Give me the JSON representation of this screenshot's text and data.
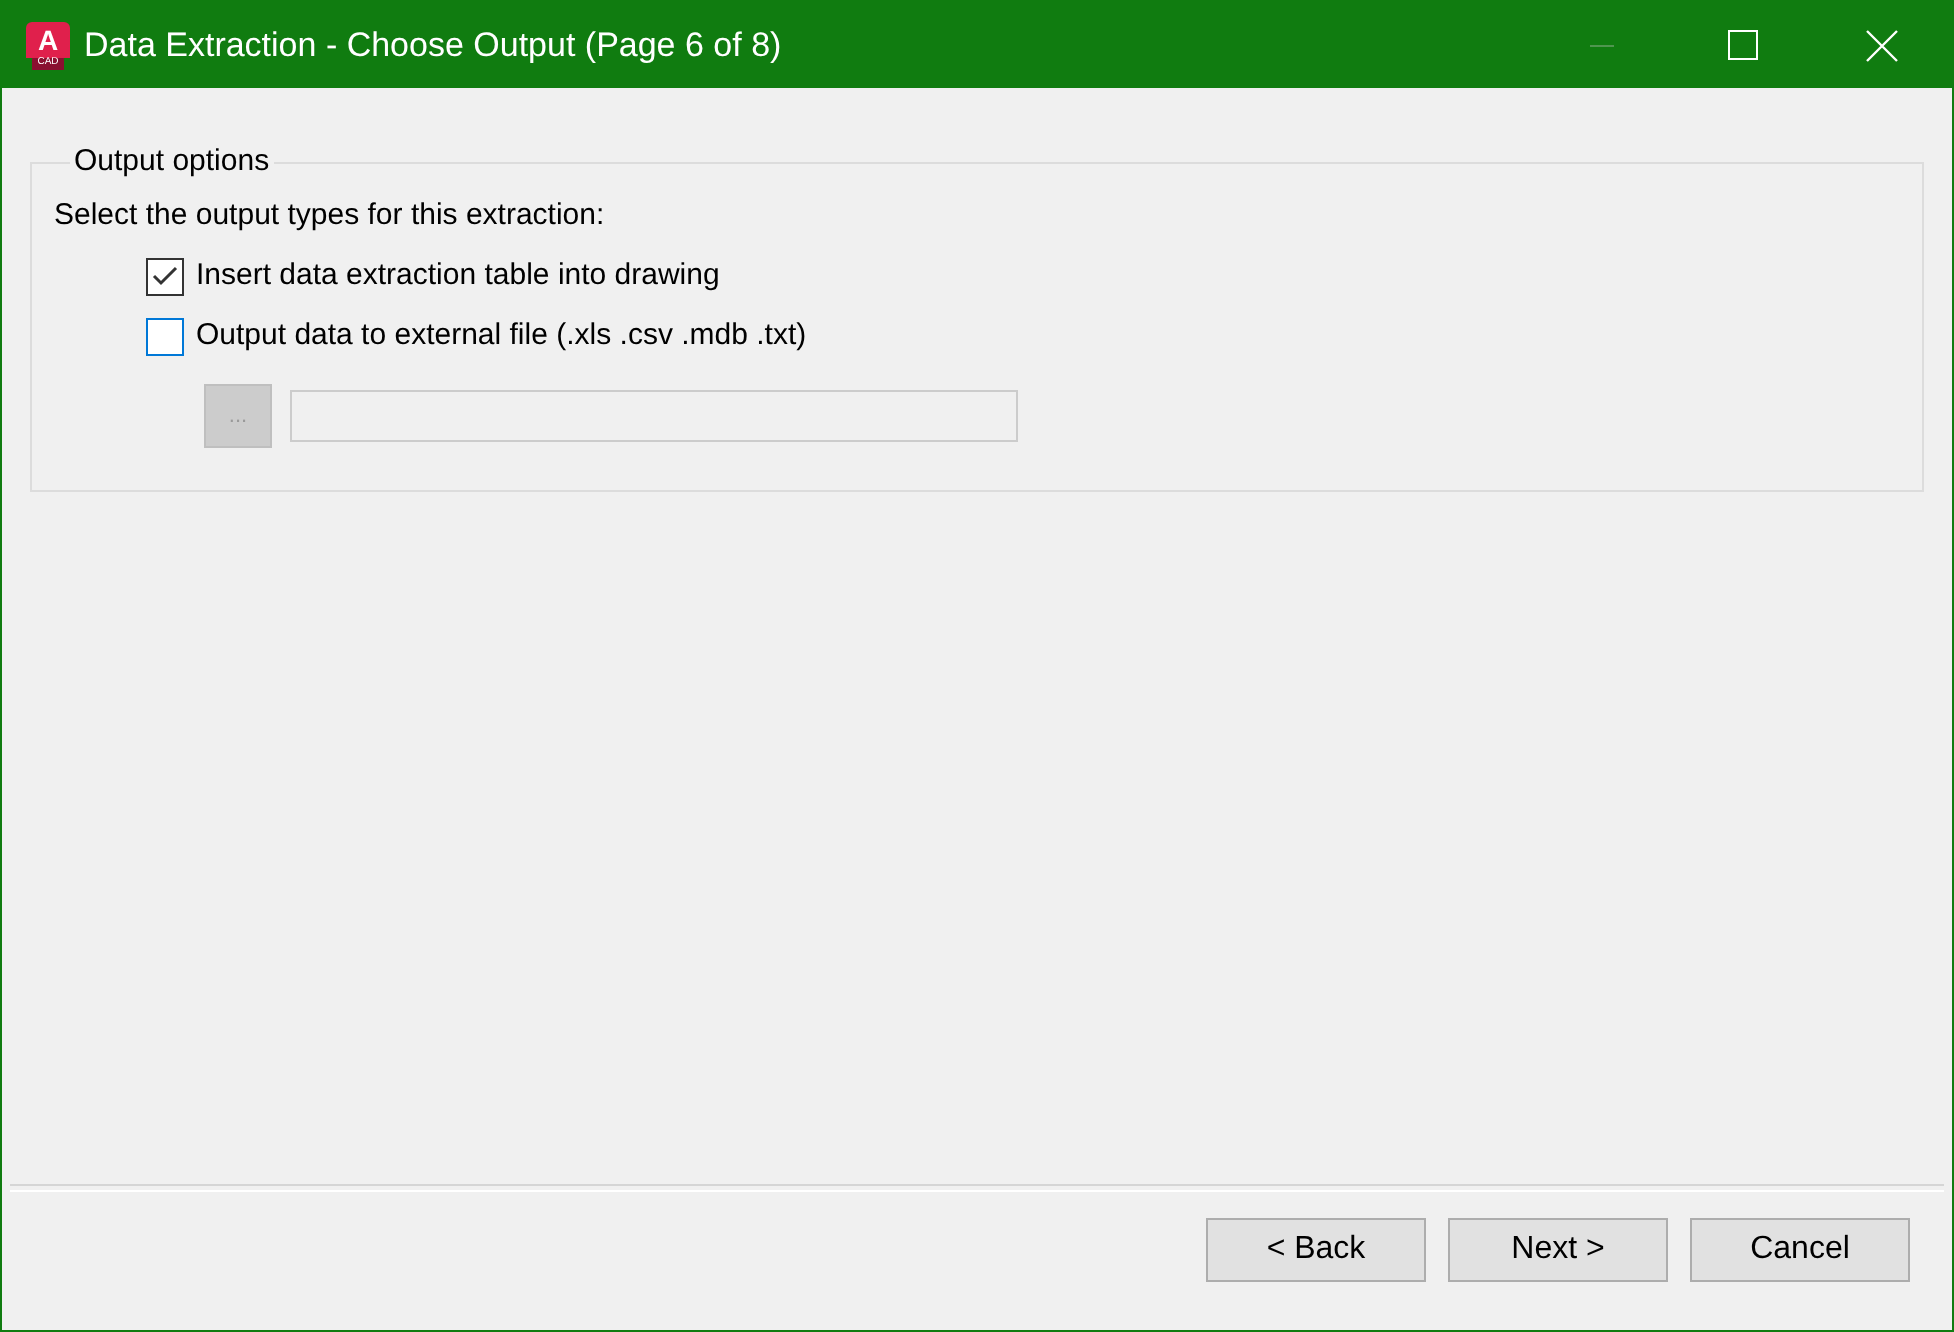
{
  "window": {
    "title": "Data Extraction - Choose Output (Page 6 of 8)",
    "app_logo": {
      "letter": "A",
      "caption": "CAD"
    },
    "controls": [
      {
        "kind": "minimize",
        "disabled": true
      },
      {
        "kind": "maximize",
        "disabled": false
      },
      {
        "kind": "close",
        "disabled": false
      }
    ]
  },
  "output_options": {
    "legend": "Output options",
    "instruction": "Select the output types for this extraction:",
    "options": [
      {
        "label": "Insert data extraction table into drawing",
        "checked": true,
        "hovered": false
      },
      {
        "label": "Output data to external file (.xls .csv .mdb .txt)",
        "checked": false,
        "hovered": true
      }
    ],
    "browse_button": {
      "label": "...",
      "disabled": true
    },
    "file_field": {
      "disabled": true
    }
  },
  "buttons": [
    {
      "label": "< Back"
    },
    {
      "label": "Next >"
    },
    {
      "label": "Cancel"
    }
  ]
}
